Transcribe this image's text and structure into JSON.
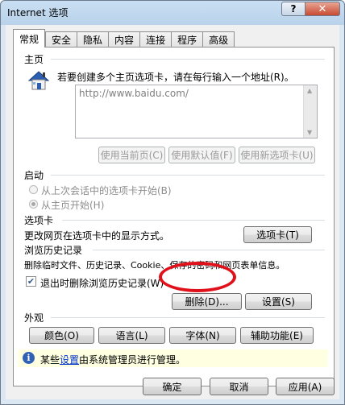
{
  "window": {
    "title": "Internet 选项",
    "help_label": "?",
    "close_label": "✕"
  },
  "tabs": [
    "常规",
    "安全",
    "隐私",
    "内容",
    "连接",
    "程序",
    "高级"
  ],
  "home": {
    "heading": "主页",
    "description": "若要创建多个主页选项卡，请在每行输入一个地址(R)。",
    "url": "http://www.baidu.com/",
    "buttons": {
      "current": "使用当前页(C)",
      "default": "使用默认值(F)",
      "new_tab": "使用新选项卡(U)"
    }
  },
  "startup": {
    "heading": "启动",
    "option_last": "从上次会话中的选项卡开始(B)",
    "option_home": "从主页开始(H)"
  },
  "tabs_section": {
    "heading": "选项卡",
    "description": "更改网页在选项卡中的显示方式。",
    "button": "选项卡(T)"
  },
  "history": {
    "heading": "浏览历史记录",
    "description": "删除临时文件、历史记录、Cookie、保存的密码和网页表单信息。",
    "checkbox_label": "退出时删除浏览历史记录(W)",
    "checkbox_checked": true,
    "delete_button": "删除(D)...",
    "settings_button": "设置(S)"
  },
  "appearance": {
    "heading": "外观",
    "buttons": {
      "colors": "颜色(O)",
      "languages": "语言(L)",
      "fonts": "字体(N)",
      "accessibility": "辅助功能(E)"
    }
  },
  "info": {
    "prefix": "某些",
    "link": "设置",
    "suffix": "由系统管理员进行管理。"
  },
  "footer": {
    "ok": "确定",
    "cancel": "取消",
    "apply": "应用(A)"
  },
  "colors": {
    "annotation": "#e0111b",
    "infobar": "#ffffe1",
    "link": "#0033cc"
  }
}
